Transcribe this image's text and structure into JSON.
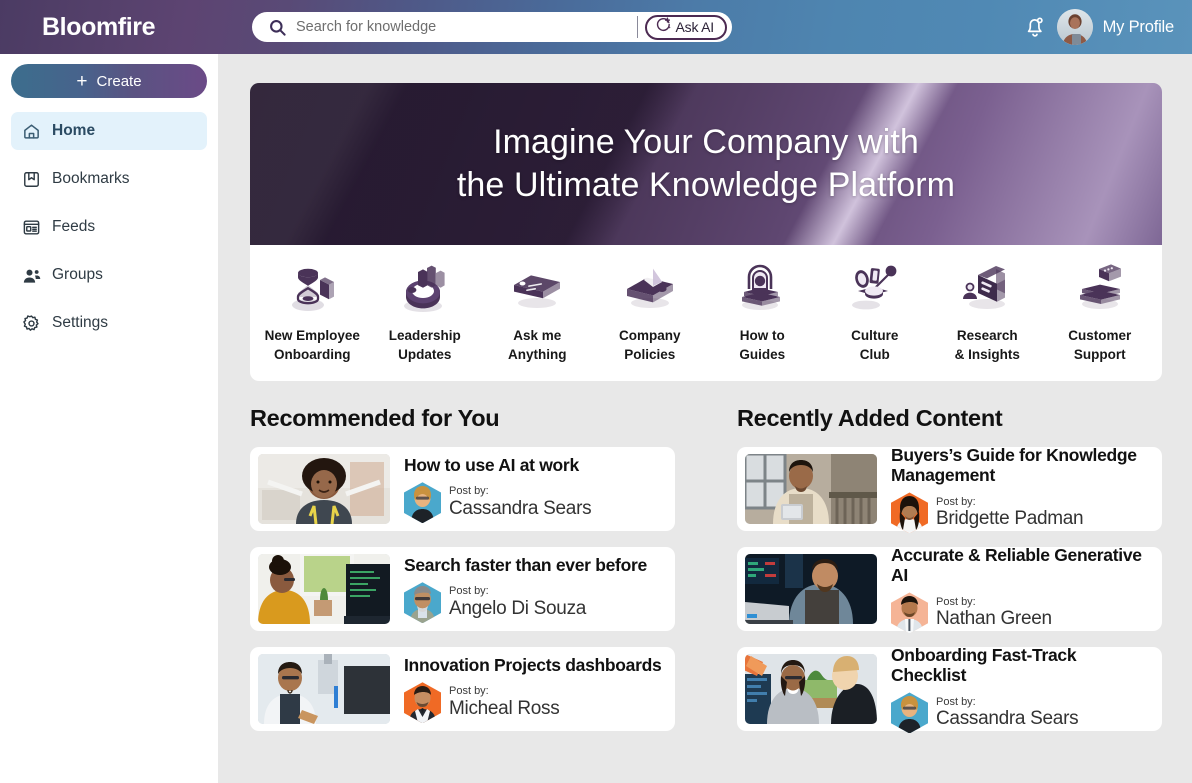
{
  "header": {
    "brand": "Bloomfire",
    "search": {
      "placeholder": "Search for knowledge",
      "value": "",
      "icon": "search-icon"
    },
    "ask_ai": {
      "label": "Ask AI",
      "icon": "ai-sparkle-icon"
    },
    "notifications": {
      "icon": "bell-icon"
    },
    "profile": {
      "label": "My Profile",
      "icon": "avatar"
    }
  },
  "sidebar": {
    "create_label": "Create",
    "create_icon": "plus-icon",
    "items": [
      {
        "label": "Home",
        "icon": "home-icon",
        "active": true
      },
      {
        "label": "Bookmarks",
        "icon": "bookmark-icon",
        "active": false
      },
      {
        "label": "Feeds",
        "icon": "feed-icon",
        "active": false
      },
      {
        "label": "Groups",
        "icon": "groups-icon",
        "active": false
      },
      {
        "label": "Settings",
        "icon": "gear-icon",
        "active": false
      }
    ]
  },
  "hero": {
    "line1": "Imagine Your Company with",
    "line2": "the Ultimate Knowledge Platform"
  },
  "tiles": [
    {
      "line1": "New Employee",
      "line2": "Onboarding",
      "icon": "hourglass-book-icon"
    },
    {
      "line1": "Leadership",
      "line2": "Updates",
      "icon": "podium-chart-icon"
    },
    {
      "line1": "Ask me",
      "line2": "Anything",
      "icon": "keyboard-icon"
    },
    {
      "line1": "Company",
      "line2": "Policies",
      "icon": "book-pyramid-icon"
    },
    {
      "line1": "How to",
      "line2": "Guides",
      "icon": "archway-steps-icon"
    },
    {
      "line1": "Culture",
      "line2": "Club",
      "icon": "balloons-icon"
    },
    {
      "line1": "Research",
      "line2": "& Insights",
      "icon": "monitor-research-icon"
    },
    {
      "line1": "Customer",
      "line2": "Support",
      "icon": "chat-steps-icon"
    }
  ],
  "recommended": {
    "title": "Recommended for You",
    "post_by_label": "Post by:",
    "cards": [
      {
        "title": "How to use AI at work",
        "author": "Cassandra Sears",
        "avatar_tint": "#4aa8cc",
        "thumb": "woman-afro-arms-crossed"
      },
      {
        "title": "Search faster than ever before",
        "author": "Angelo Di Souza",
        "avatar_tint": "#4aa8cc",
        "thumb": "woman-at-desk-window"
      },
      {
        "title": "Innovation Projects dashboards",
        "author": "Micheal Ross",
        "avatar_tint": "#f06a25",
        "thumb": "scientist-at-monitor"
      }
    ]
  },
  "recent": {
    "title": "Recently Added Content",
    "post_by_label": "Post by:",
    "cards": [
      {
        "title": "Buyers’s Guide for Knowledge Management",
        "author": "Bridgette Padman",
        "avatar_tint": "#f06a25",
        "thumb": "man-with-tablet"
      },
      {
        "title": "Accurate & Reliable Generative AI",
        "author": "Nathan Green",
        "avatar_tint": "#f5b496",
        "thumb": "man-at-laptop-dark"
      },
      {
        "title": "Onboarding Fast-Track Checklist",
        "author": "Cassandra Sears",
        "avatar_tint": "#4aa8cc",
        "thumb": "two-women-office"
      }
    ]
  },
  "colors": {
    "header_purple": "#4b3b63",
    "header_blue": "#5a93bb",
    "accent_purple": "#4c2a52",
    "active_nav_bg": "#e3f2fb",
    "page_bg": "#e8e8e8"
  }
}
